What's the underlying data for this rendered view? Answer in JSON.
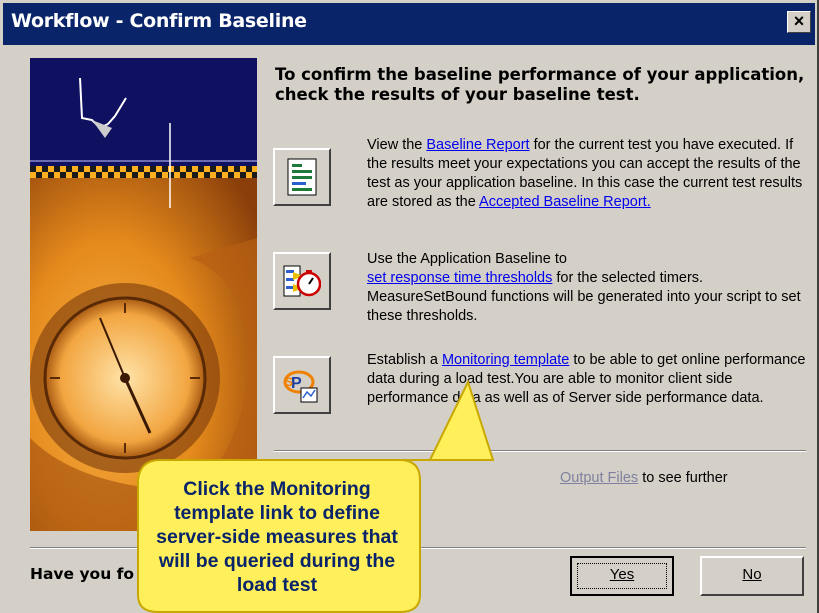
{
  "window": {
    "title": "Workflow - Confirm Baseline",
    "close_label": "×"
  },
  "heading": "To confirm the baseline performance of your application, check the results of your baseline test.",
  "sections": [
    {
      "icon": "report-document-icon",
      "pre": "View the ",
      "link": "Baseline Report",
      "mid": " for the current test you have executed. If the results meet your expectations you can accept the results of the test as your application baseline. In this case the current test results are stored as the ",
      "link2": "Accepted Baseline Report."
    },
    {
      "icon": "stopwatch-threshold-icon",
      "pre": "Use the Application Baseline to ",
      "link": "set response time thresholds",
      "mid": " for the selected timers. MeasureSetBound functions will be generated into your script to set these thresholds."
    },
    {
      "icon": "monitoring-template-icon",
      "pre": "Establish a ",
      "link": "Monitoring template",
      "mid": "  to be able to get online performance data during a load test.You are able to monitor client side performance data as well as of Server side performance data."
    },
    {
      "link": "Output Files",
      "mid": " to see further"
    }
  ],
  "footer": {
    "question": "Have you fo",
    "yes_label": "Yes",
    "no_label": "No"
  },
  "callout": {
    "text": "Click the Monitoring template link to define server-side measures that will be queried during the load test"
  }
}
